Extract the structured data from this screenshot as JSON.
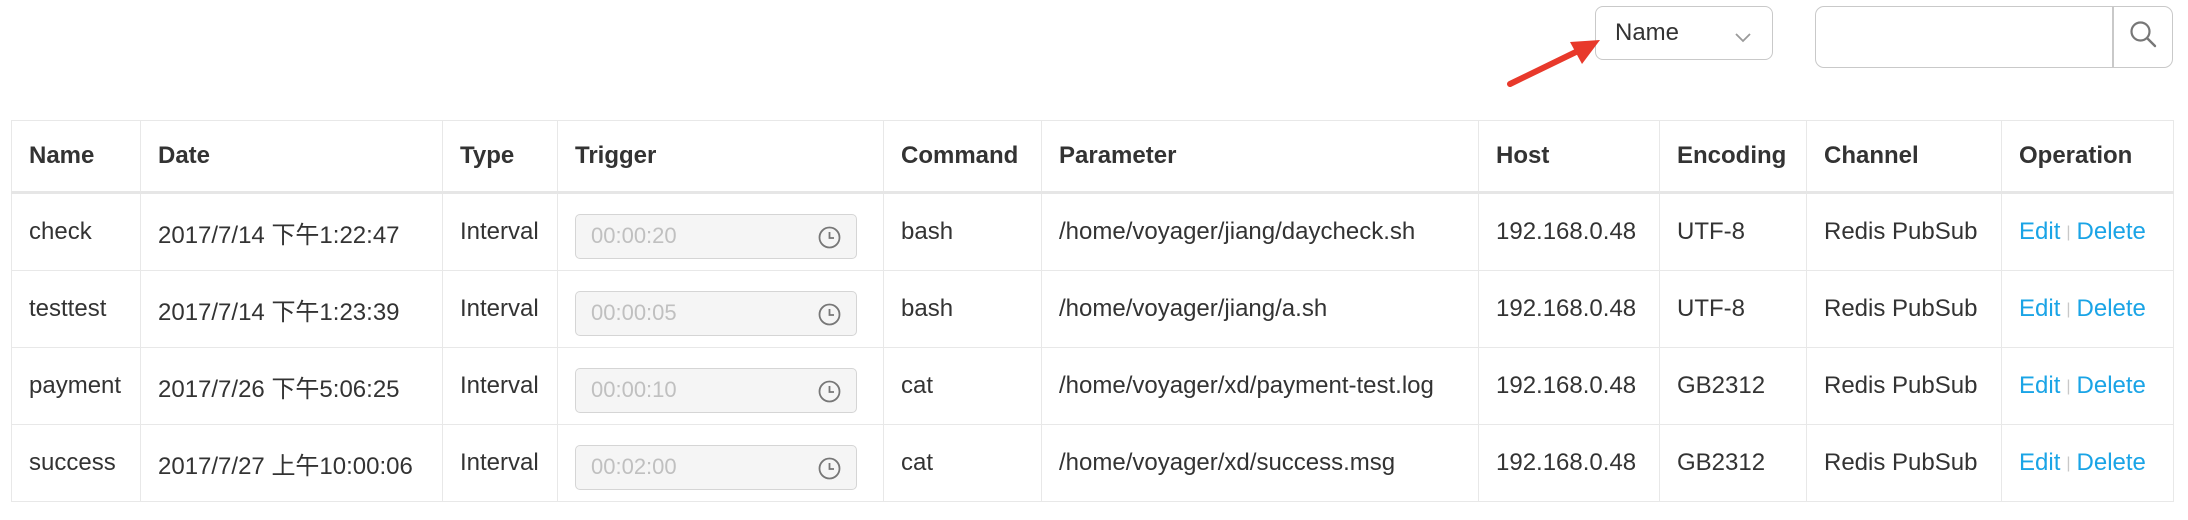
{
  "filter": {
    "selected": "Name",
    "search_placeholder": ""
  },
  "icons": {
    "dropdown": "chevron-down-icon",
    "search": "search-icon",
    "trigger": "clock-icon",
    "annotation": "red-arrow"
  },
  "colors": {
    "link": "#1aa4e6",
    "arrow": "#e8392b"
  },
  "table": {
    "headers": [
      "Name",
      "Date",
      "Type",
      "Trigger",
      "Command",
      "Parameter",
      "Host",
      "Encoding",
      "Channel",
      "Operation"
    ],
    "rows": [
      {
        "name": "check",
        "date": "2017/7/14 下午1:22:47",
        "type": "Interval",
        "trigger": "00:00:20",
        "command": "bash",
        "parameter": "/home/voyager/jiang/daycheck.sh",
        "host": "192.168.0.48",
        "encoding": "UTF-8",
        "channel": "Redis PubSub"
      },
      {
        "name": "testtest",
        "date": "2017/7/14 下午1:23:39",
        "type": "Interval",
        "trigger": "00:00:05",
        "command": "bash",
        "parameter": "/home/voyager/jiang/a.sh",
        "host": "192.168.0.48",
        "encoding": "UTF-8",
        "channel": "Redis PubSub"
      },
      {
        "name": "payment",
        "date": "2017/7/26 下午5:06:25",
        "type": "Interval",
        "trigger": "00:00:10",
        "command": "cat",
        "parameter": "/home/voyager/xd/payment-test.log",
        "host": "192.168.0.48",
        "encoding": "GB2312",
        "channel": "Redis PubSub"
      },
      {
        "name": "success",
        "date": "2017/7/27 上午10:00:06",
        "type": "Interval",
        "trigger": "00:02:00",
        "command": "cat",
        "parameter": "/home/voyager/xd/success.msg",
        "host": "192.168.0.48",
        "encoding": "GB2312",
        "channel": "Redis PubSub"
      }
    ],
    "operations": {
      "edit": "Edit",
      "delete": "Delete",
      "separator": "|"
    }
  }
}
